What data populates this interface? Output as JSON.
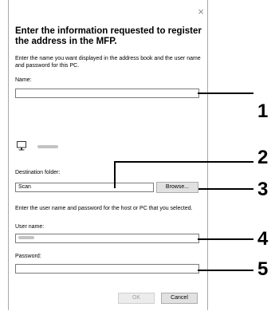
{
  "dialog": {
    "close_glyph": "×",
    "heading": "Enter the information requested to register the address in the MFP.",
    "intro": "Enter the name you want displayed in the address book and the user name and password for this PC.",
    "name_label": "Name:",
    "name_value": "",
    "destination_label": "Destination folder:",
    "destination_value": "Scan",
    "browse_label": "Browse...",
    "credentials_intro": "Enter the user name and password for the host or PC that you selected.",
    "username_label": "User name:",
    "password_label": "Password:",
    "password_value": "",
    "ok_label": "OK",
    "cancel_label": "Cancel"
  },
  "callouts": [
    "1",
    "2",
    "3",
    "4",
    "5"
  ],
  "icons": {
    "computer": "computer-icon",
    "close": "close-icon"
  }
}
